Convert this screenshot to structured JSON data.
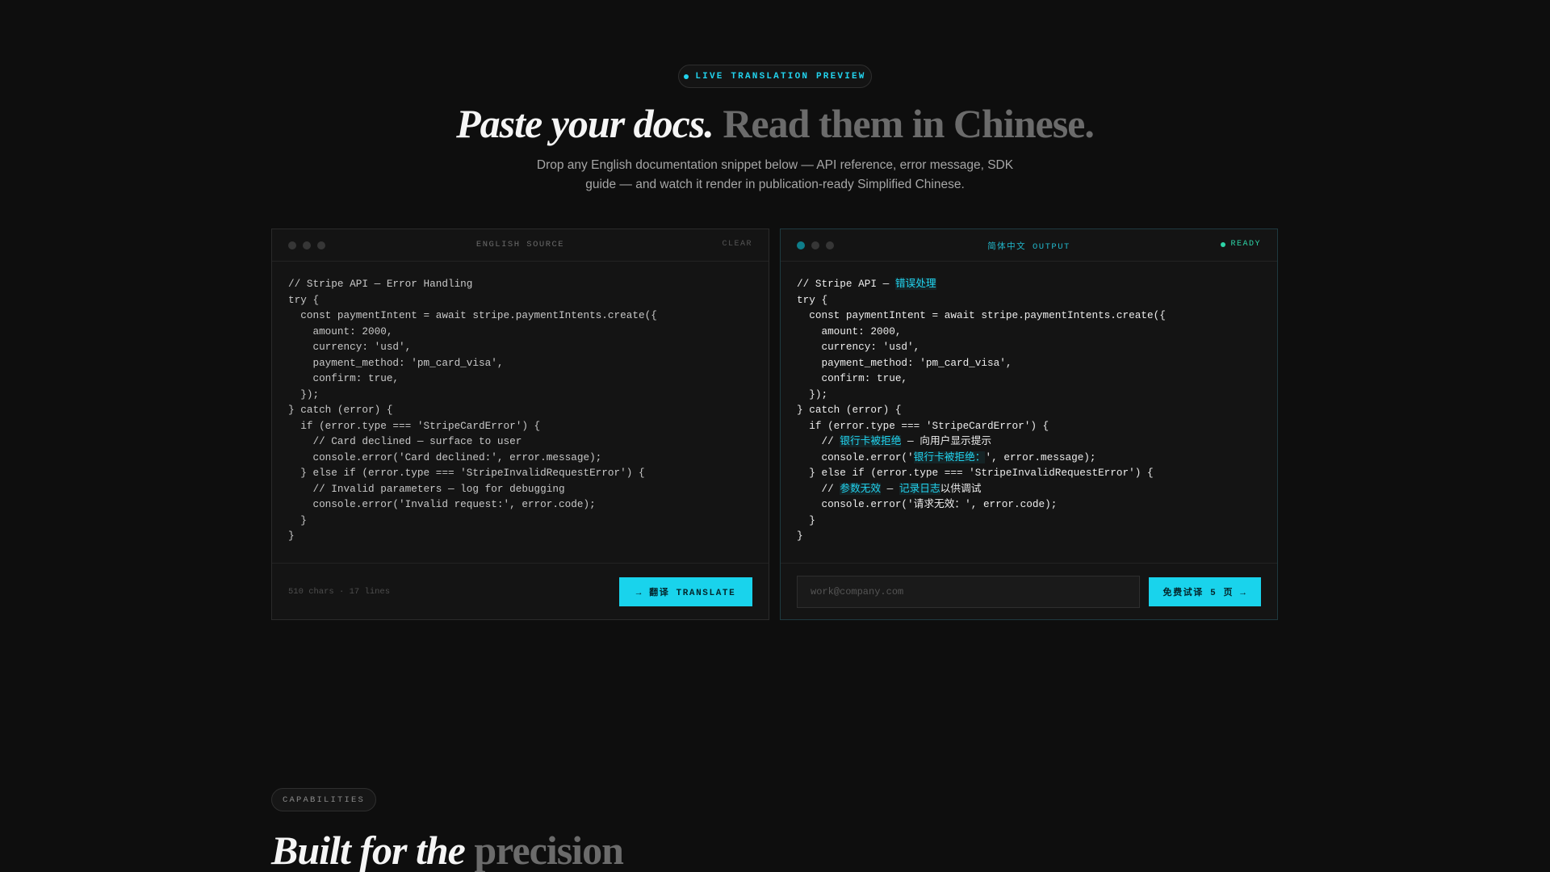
{
  "hero": {
    "badge": "LIVE TRANSLATION PREVIEW",
    "title_em": "Paste your docs.",
    "title_muted": "Read them in Chinese.",
    "subtitle": "Drop any English documentation snippet below — API reference, error message, SDK guide — and watch it render in publication-ready Simplified Chinese."
  },
  "source_panel": {
    "title": "ENGLISH SOURCE",
    "action": "CLEAR",
    "lines": [
      "// Stripe API — Error Handling",
      "try {",
      "  const paymentIntent = await stripe.paymentIntents.create({",
      "    amount: 2000,",
      "    currency: 'usd',",
      "    payment_method: 'pm_card_visa',",
      "    confirm: true,",
      "  });",
      "} catch (error) {",
      "  if (error.type === 'StripeCardError') {",
      "    // Card declined — surface to user",
      "    console.error('Card declined:', error.message);",
      "  } else if (error.type === 'StripeInvalidRequestError') {",
      "    // Invalid parameters — log for debugging",
      "    console.error('Invalid request:', error.code);",
      "  }",
      "}"
    ],
    "meta": "510 chars · 17 lines",
    "button": "→ 翻译 TRANSLATE"
  },
  "output_panel": {
    "title": "简体中文 OUTPUT",
    "status": "READY",
    "lines": [
      [
        {
          "t": "// Stripe API — "
        },
        {
          "t": "错误处理",
          "hl": true
        }
      ],
      [
        {
          "t": "try {"
        }
      ],
      [
        {
          "t": "  const paymentIntent = await stripe.paymentIntents.create({"
        }
      ],
      [
        {
          "t": "    amount: 2000,"
        }
      ],
      [
        {
          "t": "    currency: 'usd',"
        }
      ],
      [
        {
          "t": "    payment_method: 'pm_card_visa',"
        }
      ],
      [
        {
          "t": "    confirm: true,"
        }
      ],
      [
        {
          "t": "  });"
        }
      ],
      [
        {
          "t": "} catch (error) {"
        }
      ],
      [
        {
          "t": "  if (error.type === 'StripeCardError') {"
        }
      ],
      [
        {
          "t": "    // "
        },
        {
          "t": "银行卡被拒绝",
          "hl": true
        },
        {
          "t": " — 向用户显示提示"
        }
      ],
      [
        {
          "t": "    console.error('"
        },
        {
          "t": "银行卡被拒绝：",
          "hl": true
        },
        {
          "t": "', error.message);"
        }
      ],
      [
        {
          "t": "  } else if (error.type === 'StripeInvalidRequestError') {"
        }
      ],
      [
        {
          "t": "    // "
        },
        {
          "t": "参数无效",
          "hl": true
        },
        {
          "t": " — "
        },
        {
          "t": "记录日志",
          "hl": true
        },
        {
          "t": "以供调试"
        }
      ],
      [
        {
          "t": "    console.error('请求无效：', error.code);"
        }
      ],
      [
        {
          "t": "  }"
        }
      ],
      [
        {
          "t": "}"
        }
      ]
    ],
    "email_placeholder": "work@company.com",
    "email_value": "",
    "button": "免费试译 5 页 →"
  },
  "capabilities": {
    "badge": "CAPABILITIES",
    "title_em": "Built for the",
    "title_muted": "precision"
  },
  "colors": {
    "accent": "#22d3ee",
    "ready": "#2dd4a7",
    "background": "#0e0e0e"
  }
}
